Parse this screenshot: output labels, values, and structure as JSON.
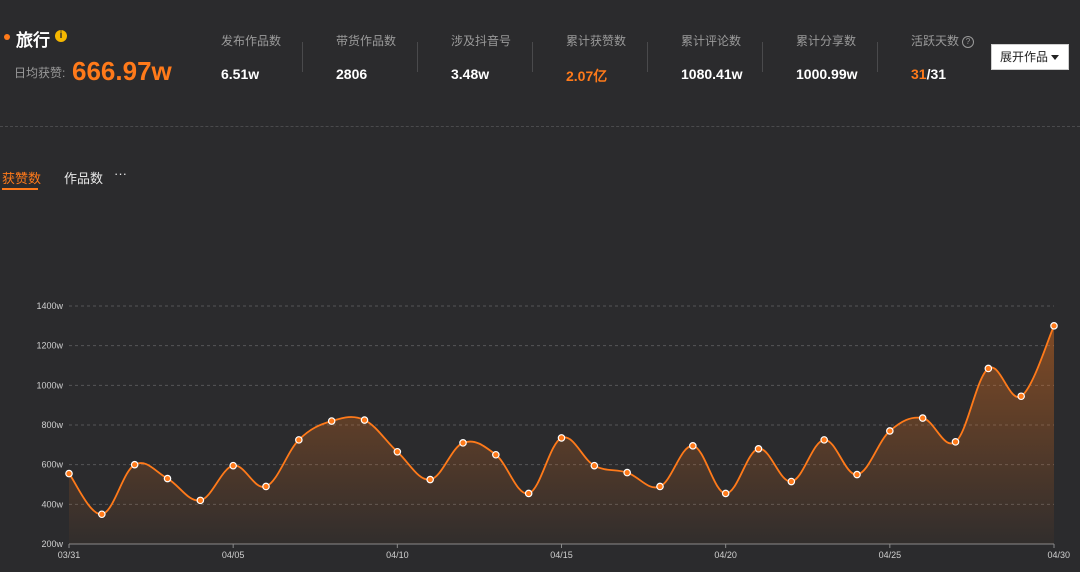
{
  "header": {
    "title": "旅行",
    "info_icon": "i",
    "avg_label": "日均获赞:",
    "avg_value": "666.97w"
  },
  "stats": [
    {
      "label": "发布作品数",
      "value": "6.51w"
    },
    {
      "label": "带货作品数",
      "value": "2806"
    },
    {
      "label": "涉及抖音号",
      "value": "3.48w"
    },
    {
      "label": "累计获赞数",
      "value": "2.07亿"
    },
    {
      "label": "累计评论数",
      "value": "1080.41w"
    },
    {
      "label": "累计分享数",
      "value": "1000.99w"
    },
    {
      "label": "活跃天数",
      "value_active": "31",
      "value_total": "/31",
      "help_icon": "?"
    }
  ],
  "expand_button": {
    "label": "展开作品"
  },
  "tabs": [
    {
      "label": "获赞数",
      "active": true
    },
    {
      "label": "作品数",
      "active": false
    }
  ],
  "more_label": "···",
  "colors": {
    "accent": "#ff7a1a",
    "background": "#2b2b2d"
  },
  "chart_data": {
    "type": "area",
    "title": "",
    "xlabel": "",
    "ylabel": "",
    "ylim": [
      200,
      1400
    ],
    "yticks": [
      200,
      400,
      600,
      800,
      1000,
      1200,
      1400
    ],
    "ytick_labels": [
      "200w",
      "400w",
      "600w",
      "800w",
      "1000w",
      "1200w",
      "1400w"
    ],
    "x": [
      "03/31",
      "04/01",
      "04/02",
      "04/03",
      "04/04",
      "04/05",
      "04/06",
      "04/07",
      "04/08",
      "04/09",
      "04/10",
      "04/11",
      "04/12",
      "04/13",
      "04/14",
      "04/15",
      "04/16",
      "04/17",
      "04/18",
      "04/19",
      "04/20",
      "04/21",
      "04/22",
      "04/23",
      "04/24",
      "04/25",
      "04/26",
      "04/27",
      "04/28",
      "04/29",
      "04/30"
    ],
    "xtick_labels": [
      "03/31",
      "04/05",
      "04/10",
      "04/15",
      "04/20",
      "04/25",
      "04/30"
    ],
    "grid": true,
    "series": [
      {
        "values": [
          555,
          350,
          600,
          530,
          420,
          595,
          490,
          725,
          820,
          825,
          665,
          525,
          710,
          650,
          455,
          735,
          595,
          560,
          490,
          695,
          455,
          680,
          515,
          725,
          550,
          770,
          835,
          715,
          1085,
          945,
          1300
        ]
      }
    ]
  }
}
